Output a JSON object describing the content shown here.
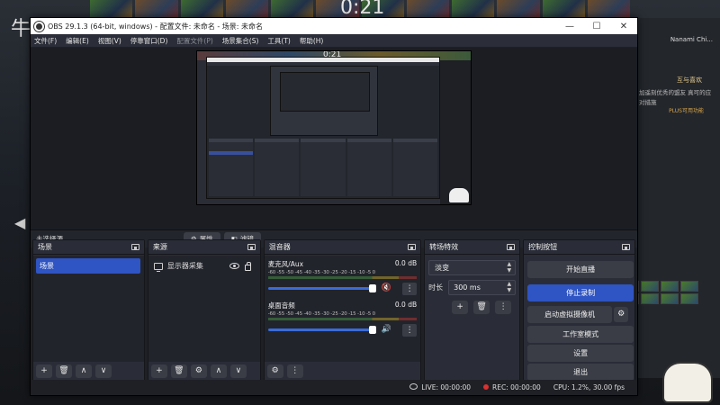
{
  "game": {
    "timer": "0:21",
    "left_glyph": "牛",
    "right_name": "Nanami Chi...",
    "right_heading": "互与喜欢",
    "right_text": "加遥刻优秀的盟友 真可的应对措施",
    "right_link": "PLUS可用功能"
  },
  "window": {
    "title": "OBS 29.1.3 (64-bit, windows) - 配置文件: 未命名 - 场景: 未命名",
    "minimize": "—",
    "maximize": "☐",
    "close": "✕"
  },
  "menu": [
    "文件(F)",
    "编辑(E)",
    "视图(V)",
    "停靠窗口(D)",
    "配置文件(P)",
    "场景集合(S)",
    "工具(T)",
    "帮助(H)"
  ],
  "preview": {
    "inner_timer": "0:21"
  },
  "context_bar": {
    "no_source": "未选择源",
    "properties": "属性",
    "filters": "滤镜"
  },
  "docks": {
    "scenes": {
      "title": "场景",
      "items": [
        "场景"
      ]
    },
    "sources": {
      "title": "来源",
      "items": [
        "显示器采集"
      ]
    },
    "mixer": {
      "title": "混音器",
      "scale": "-60 -55 -50 -45 -40 -35 -30 -25 -20 -15 -10 -5 0",
      "channels": [
        {
          "name": "麦克风/Aux",
          "db": "0.0 dB"
        },
        {
          "name": "桌面音频",
          "db": "0.0 dB"
        }
      ]
    },
    "transitions": {
      "title": "转场特效",
      "selected": "淡变",
      "duration_label": "时长",
      "duration": "300 ms"
    },
    "controls": {
      "title": "控制按钮",
      "buttons": [
        "开始直播",
        "停止录制",
        "启动虚拟摄像机",
        "工作室模式",
        "设置",
        "退出"
      ]
    }
  },
  "status": {
    "live": "LIVE: 00:00:00",
    "rec": "REC: 00:00:00",
    "cpu": "CPU: 1.2%, 30.00 fps"
  },
  "colors": {
    "accent": "#2f54c3",
    "rec": "#d93030",
    "panel": "#2a2d37"
  }
}
